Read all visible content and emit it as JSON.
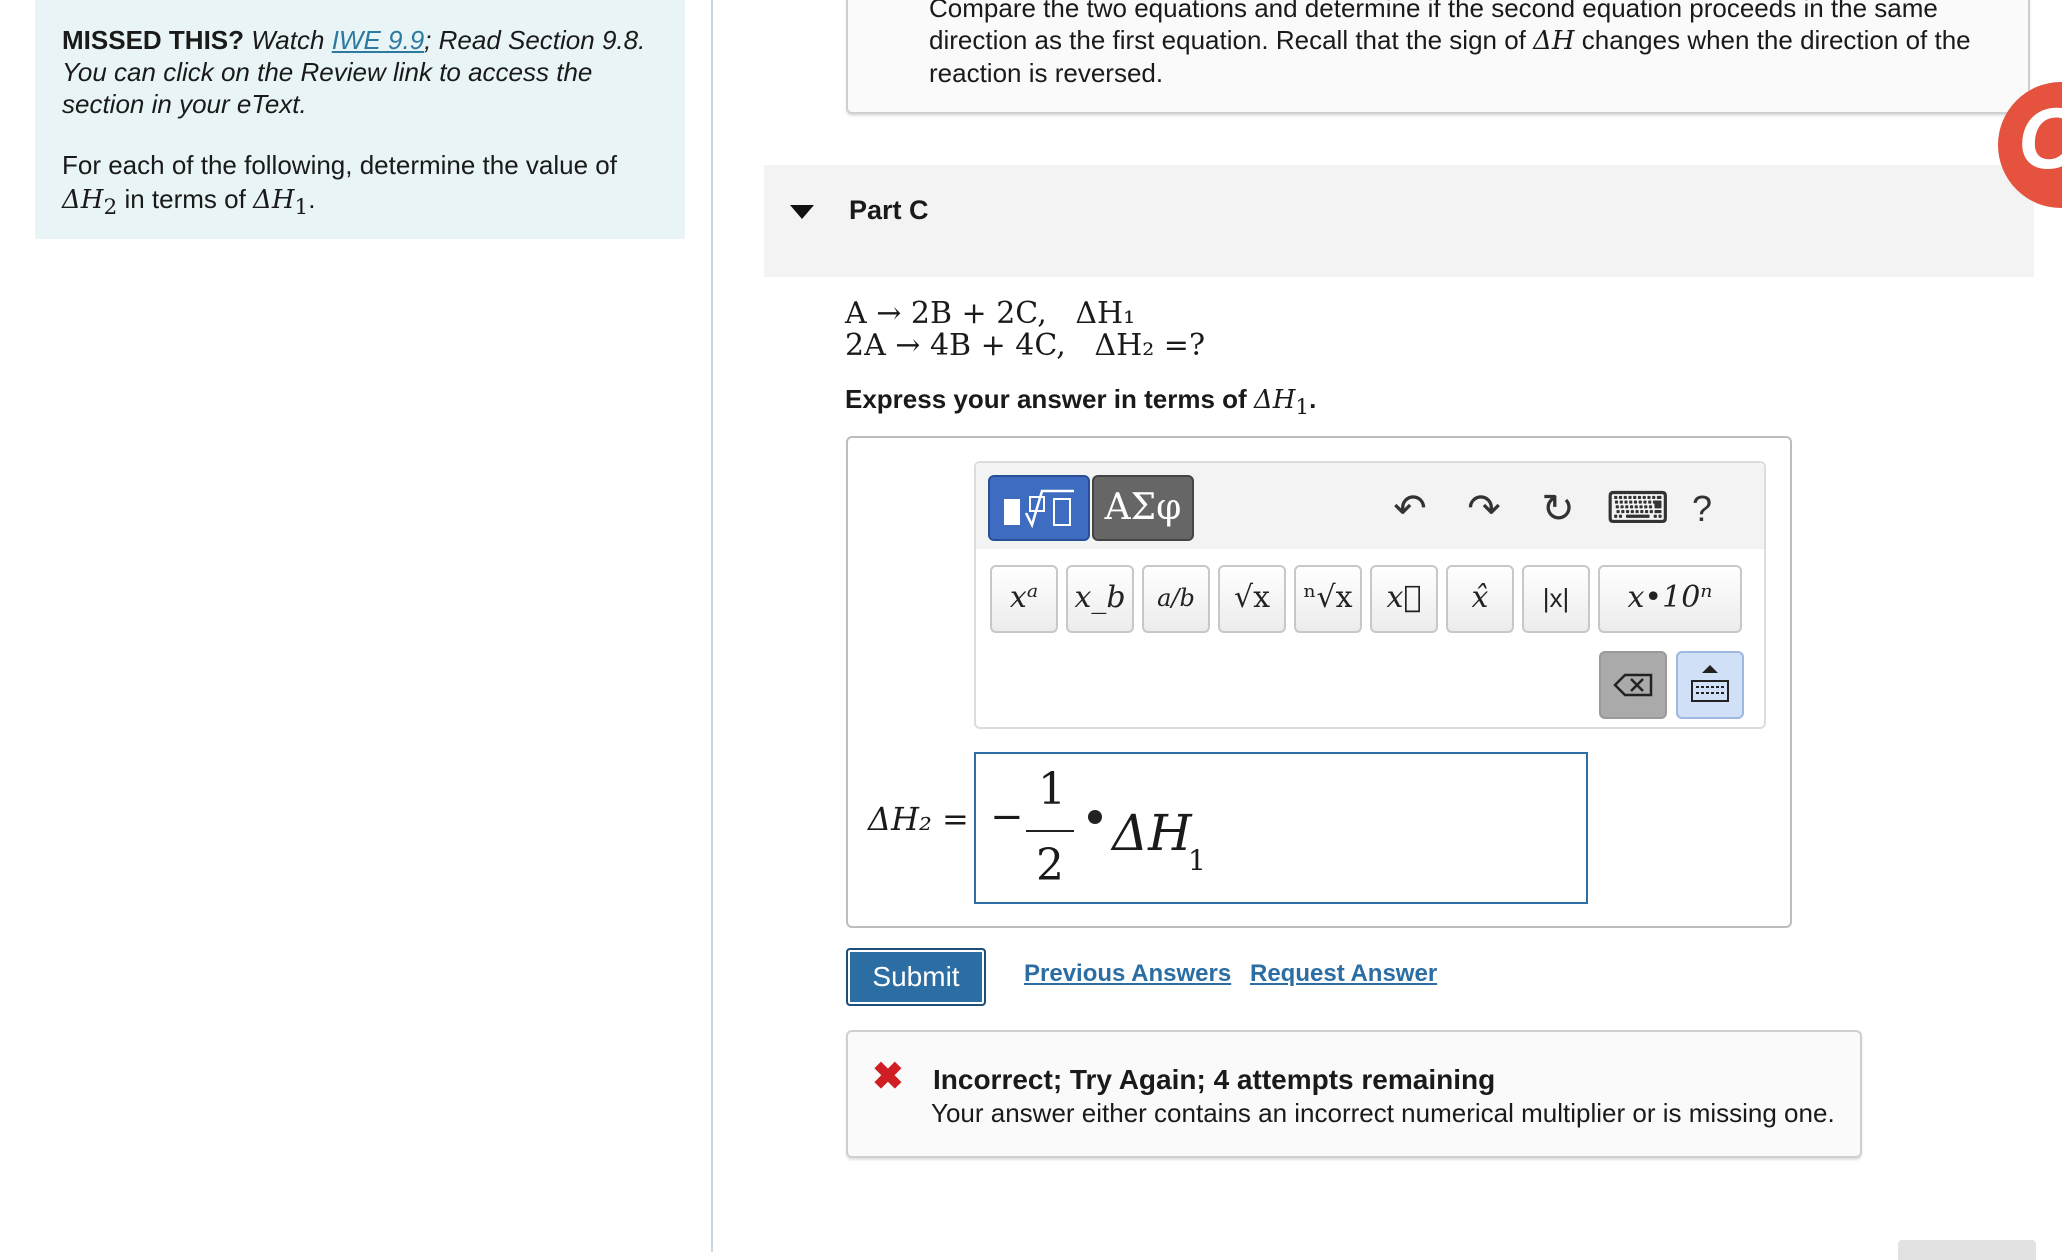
{
  "info": {
    "missed_label": "MISSED THIS?",
    "watch_text": " Watch ",
    "iwe_link": "IWE 9.9",
    "read_text": "; Read Section 9.8. You can click on the Review link to access the section in your eText.",
    "instruction_prefix": "For each of the following, determine the value of ",
    "instruction_dh2": "ΔH",
    "instruction_sub2": "2",
    "instruction_mid": " in terms of ",
    "instruction_dh1": "ΔH",
    "instruction_sub1": "1",
    "instruction_end": "."
  },
  "hint": {
    "line1": "Compare the two equations and determine if the second equation proceeds in the same",
    "line2_a": "direction as the first equation. Recall that the sign of ",
    "line2_dh": "ΔH",
    "line2_b": " changes when the direction of the",
    "line3": "reaction is reversed."
  },
  "part": {
    "title": "Part C"
  },
  "equations": {
    "eq1": "A → 2B + 2C,   ΔH₁",
    "eq2": "2A → 4B + 4C,   ΔH₂ =?"
  },
  "prompt": {
    "prefix": "Express your answer in terms of ",
    "dh": "ΔH",
    "sub": "1",
    "end": "."
  },
  "toolbar": {
    "symbols_tab": "ΑΣφ",
    "undo": "↶",
    "redo": "↷",
    "reset": "↻",
    "keyboard": "⌨",
    "help": "?",
    "keys": [
      "xᵃ",
      "x_b",
      "a/b",
      "√x",
      "ⁿ√x",
      "x⃗",
      "x̂",
      "|x|",
      "x•10ⁿ"
    ]
  },
  "answer": {
    "label": "ΔH₂ =",
    "minus": "−",
    "numerator": "1",
    "denominator": "2",
    "var": "ΔH",
    "sub": "1"
  },
  "actions": {
    "submit": "Submit",
    "previous_answers": "Previous Answers",
    "request_answer": "Request Answer"
  },
  "feedback": {
    "icon": "✖",
    "title": "Incorrect; Try Again; 4 attempts remaining",
    "detail": "Your answer either contains an incorrect numerical multiplier or is missing one."
  },
  "colors": {
    "accent": "#2c6ea3",
    "error": "#d01f24",
    "info_bg": "#e8f4f6"
  }
}
